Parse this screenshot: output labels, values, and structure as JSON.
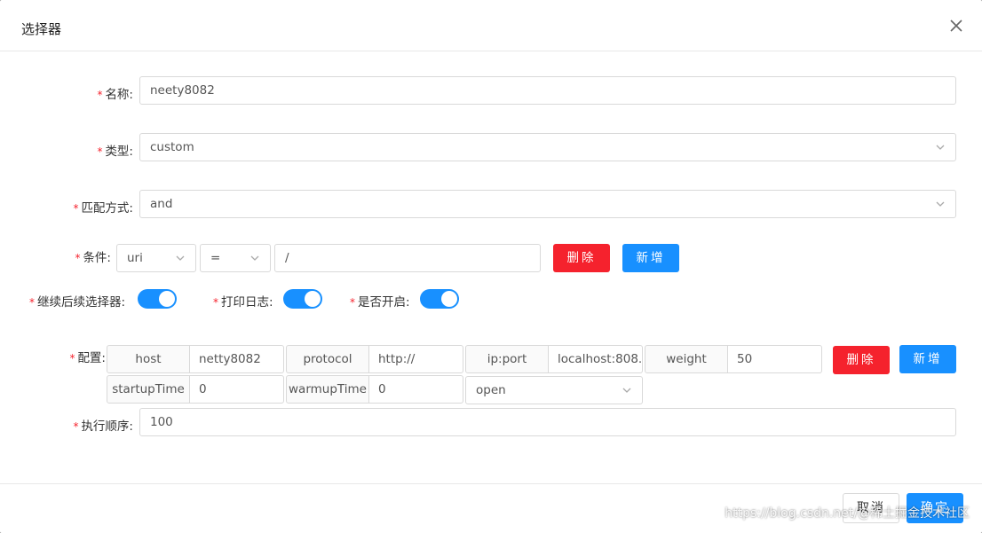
{
  "modal": {
    "title": "选择器"
  },
  "form": {
    "name": {
      "label": "名称:",
      "value": "neety8082"
    },
    "type": {
      "label": "类型:",
      "value": "custom"
    },
    "match_mode": {
      "label": "匹配方式:",
      "value": "and"
    },
    "condition": {
      "label": "条件:",
      "param_type": "uri",
      "operator": "=",
      "value": "/",
      "delete_label": "删除",
      "add_label": "新增"
    },
    "switches": {
      "continue": {
        "label": "继续后续选择器:",
        "on": true
      },
      "log": {
        "label": "打印日志:",
        "on": true
      },
      "enabled": {
        "label": "是否开启:",
        "on": true
      }
    },
    "config": {
      "label": "配置:",
      "host_label": "host",
      "host_value": "netty8082",
      "protocol_label": "protocol",
      "protocol_value": "http://",
      "ipport_label": "ip:port",
      "ipport_value": "localhost:808.",
      "weight_label": "weight",
      "weight_value": "50",
      "startup_label": "startupTime",
      "startup_value": "0",
      "warmup_label": "warmupTime",
      "warmup_value": "0",
      "status_value": "open",
      "delete_label": "删除",
      "add_label": "新增"
    },
    "order": {
      "label": "执行顺序:",
      "value": "100"
    }
  },
  "footer": {
    "cancel_label": "取消",
    "ok_label": "确定",
    "watermark": "https://blog.csdn.net/@稀土掘金技术社区"
  },
  "colors": {
    "primary": "#1890ff",
    "danger": "#f5222d",
    "required": "#f5222d"
  }
}
